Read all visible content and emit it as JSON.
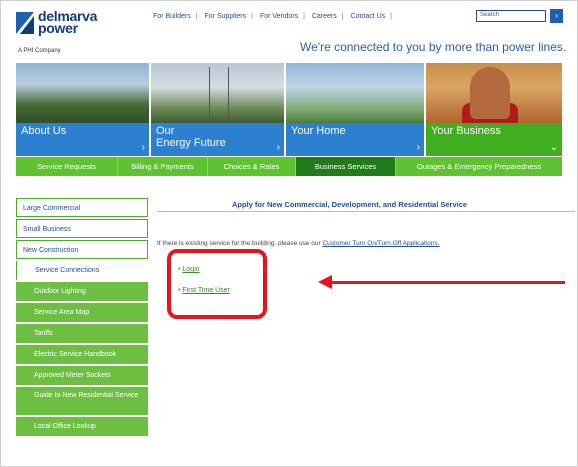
{
  "header": {
    "logo_line1": "delmarva",
    "logo_line2": "power",
    "logo_sub": "A PHI Company",
    "top_links": [
      "For Builders",
      "For Suppliers",
      "For Vendors",
      "Careers",
      "Contact Us"
    ],
    "search_placeholder": "Search",
    "tagline": "We're connected to you by more than power lines."
  },
  "hero": {
    "panels": [
      {
        "label": "About Us"
      },
      {
        "label_line1": "Our",
        "label_line2": "Energy Future"
      },
      {
        "label": "Your Home"
      },
      {
        "label": "Your Business"
      }
    ]
  },
  "nav": {
    "items": [
      "Service Requests",
      "Billing & Payments",
      "Choices & Rates",
      "Business Services",
      "Outages & Emergency Preparedness"
    ],
    "active": "Business Services"
  },
  "sidebar": {
    "items": [
      "Large Commercial",
      "Small Business",
      "New Construction",
      "Service Connections",
      "Outdoor Lighting",
      "Service Area Map",
      "Tariffs",
      "Electric Service Handbook",
      "Approved Meter Sockets",
      "Guide to New Residential Service",
      "Local Office Lookup"
    ]
  },
  "content": {
    "title": "Apply for New Commercial, Development, and Residential Service",
    "notice_prefix": "If there is existing service for the building, please use our",
    "notice_link": "Customer Turn On/Turn Off Applications.",
    "links": [
      "Login",
      "First Time User"
    ]
  },
  "colors": {
    "accent_green": "#5fc230",
    "active_green": "#227a1a",
    "brand_blue": "#1f4f96",
    "annotation_red": "#e8141c"
  }
}
